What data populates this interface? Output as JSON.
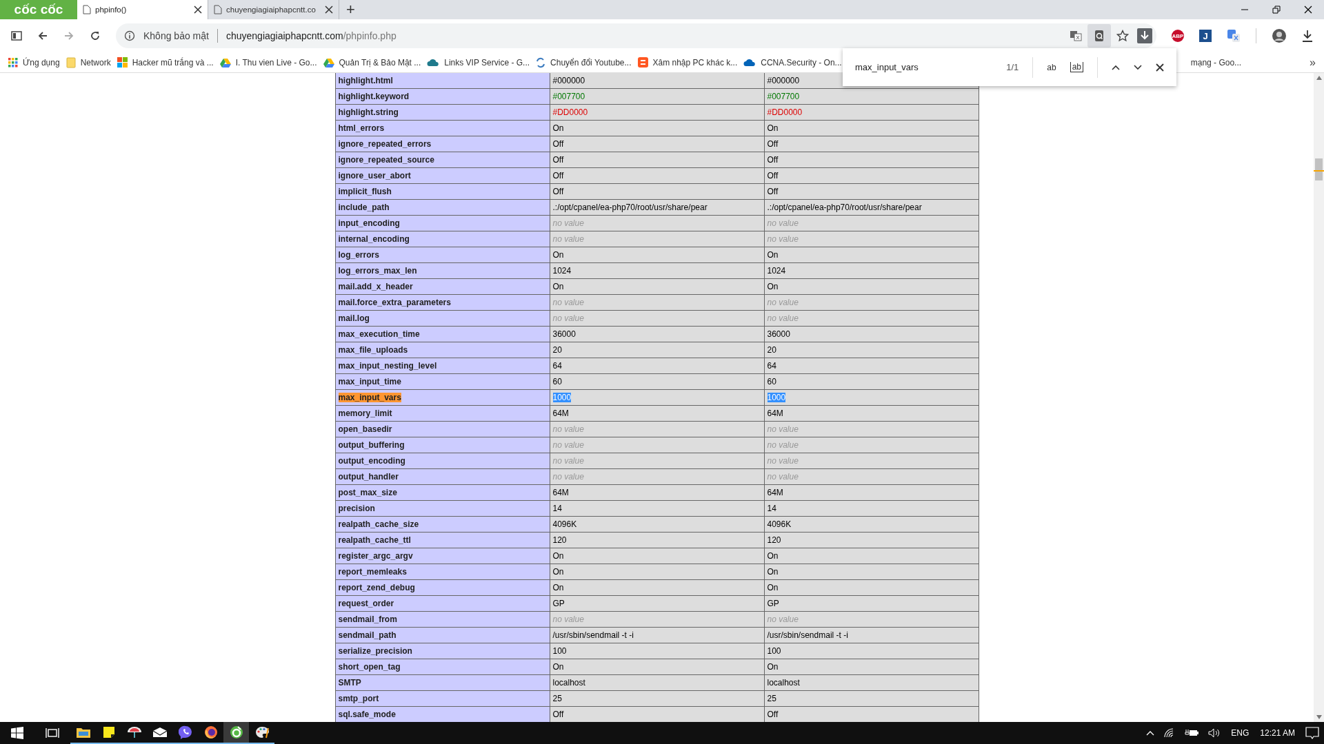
{
  "browser": {
    "logo": "cốc cốc",
    "tabs": [
      {
        "title": "phpinfo()",
        "selected": true
      },
      {
        "title": "chuyengiagiaiphapcntt.co",
        "selected": false
      }
    ],
    "new_tab": "+",
    "security": "Không bảo mật",
    "url_host": "chuyengiagiaiphapcntt.com",
    "url_path": "/phpinfo.php",
    "bookmarks": [
      {
        "label": "Ứng dụng",
        "kind": "apps"
      },
      {
        "label": "Network",
        "kind": "folder"
      },
      {
        "label": "Hacker mũ trắng và ...",
        "kind": "tiles"
      },
      {
        "label": "I. Thu vien Live - Go...",
        "kind": "drive"
      },
      {
        "label": "Quản Trị & Bảo Mật ...",
        "kind": "drive"
      },
      {
        "label": "Links VIP Service - G...",
        "kind": "cloud"
      },
      {
        "label": "Chuyển đổi Youtube...",
        "kind": "sync"
      },
      {
        "label": "Xâm nhập PC khác k...",
        "kind": "blog"
      },
      {
        "label": "CCNA.Security - On...",
        "kind": "onedrive"
      }
    ],
    "bookmark_partial": "mạng - Goo...",
    "bookmarks_more": "»",
    "extensions": [
      {
        "label": "ABP",
        "kind": "abp"
      },
      {
        "label": "J",
        "kind": "j"
      }
    ]
  },
  "find_bar": {
    "query": "max_input_vars",
    "count": "1/1",
    "match_case": "ab",
    "whole_word": "ab"
  },
  "table": {
    "rows": [
      {
        "name": "highlight.html",
        "found": false,
        "cells": [
          {
            "text": "#000000",
            "kind": "plain"
          },
          {
            "text": "#000000",
            "kind": "plain"
          }
        ]
      },
      {
        "name": "highlight.keyword",
        "found": false,
        "cells": [
          {
            "text": "#007700",
            "kind": "colored",
            "color": "#007700"
          },
          {
            "text": "#007700",
            "kind": "colored",
            "color": "#007700"
          }
        ]
      },
      {
        "name": "highlight.string",
        "found": false,
        "cells": [
          {
            "text": "#DD0000",
            "kind": "colored",
            "color": "#dd0000"
          },
          {
            "text": "#DD0000",
            "kind": "colored",
            "color": "#dd0000"
          }
        ]
      },
      {
        "name": "html_errors",
        "found": false,
        "cells": [
          {
            "text": "On",
            "kind": "plain"
          },
          {
            "text": "On",
            "kind": "plain"
          }
        ]
      },
      {
        "name": "ignore_repeated_errors",
        "found": false,
        "cells": [
          {
            "text": "Off",
            "kind": "plain"
          },
          {
            "text": "Off",
            "kind": "plain"
          }
        ]
      },
      {
        "name": "ignore_repeated_source",
        "found": false,
        "cells": [
          {
            "text": "Off",
            "kind": "plain"
          },
          {
            "text": "Off",
            "kind": "plain"
          }
        ]
      },
      {
        "name": "ignore_user_abort",
        "found": false,
        "cells": [
          {
            "text": "Off",
            "kind": "plain"
          },
          {
            "text": "Off",
            "kind": "plain"
          }
        ]
      },
      {
        "name": "implicit_flush",
        "found": false,
        "cells": [
          {
            "text": "Off",
            "kind": "plain"
          },
          {
            "text": "Off",
            "kind": "plain"
          }
        ]
      },
      {
        "name": "include_path",
        "found": false,
        "cells": [
          {
            "text": ".:/opt/cpanel/ea-php70/root/usr/share/pear",
            "kind": "plain"
          },
          {
            "text": ".:/opt/cpanel/ea-php70/root/usr/share/pear",
            "kind": "plain"
          }
        ]
      },
      {
        "name": "input_encoding",
        "found": false,
        "cells": [
          {
            "text": "no value",
            "kind": "empty"
          },
          {
            "text": "no value",
            "kind": "empty"
          }
        ]
      },
      {
        "name": "internal_encoding",
        "found": false,
        "cells": [
          {
            "text": "no value",
            "kind": "empty"
          },
          {
            "text": "no value",
            "kind": "empty"
          }
        ]
      },
      {
        "name": "log_errors",
        "found": false,
        "cells": [
          {
            "text": "On",
            "kind": "plain"
          },
          {
            "text": "On",
            "kind": "plain"
          }
        ]
      },
      {
        "name": "log_errors_max_len",
        "found": false,
        "cells": [
          {
            "text": "1024",
            "kind": "plain"
          },
          {
            "text": "1024",
            "kind": "plain"
          }
        ]
      },
      {
        "name": "mail.add_x_header",
        "found": false,
        "cells": [
          {
            "text": "On",
            "kind": "plain"
          },
          {
            "text": "On",
            "kind": "plain"
          }
        ]
      },
      {
        "name": "mail.force_extra_parameters",
        "found": false,
        "cells": [
          {
            "text": "no value",
            "kind": "empty"
          },
          {
            "text": "no value",
            "kind": "empty"
          }
        ]
      },
      {
        "name": "mail.log",
        "found": false,
        "cells": [
          {
            "text": "no value",
            "kind": "empty"
          },
          {
            "text": "no value",
            "kind": "empty"
          }
        ]
      },
      {
        "name": "max_execution_time",
        "found": false,
        "cells": [
          {
            "text": "36000",
            "kind": "plain"
          },
          {
            "text": "36000",
            "kind": "plain"
          }
        ]
      },
      {
        "name": "max_file_uploads",
        "found": false,
        "cells": [
          {
            "text": "20",
            "kind": "plain"
          },
          {
            "text": "20",
            "kind": "plain"
          }
        ]
      },
      {
        "name": "max_input_nesting_level",
        "found": false,
        "cells": [
          {
            "text": "64",
            "kind": "plain"
          },
          {
            "text": "64",
            "kind": "plain"
          }
        ]
      },
      {
        "name": "max_input_time",
        "found": false,
        "cells": [
          {
            "text": "60",
            "kind": "plain"
          },
          {
            "text": "60",
            "kind": "plain"
          }
        ]
      },
      {
        "name": "max_input_vars",
        "found": true,
        "cells": [
          {
            "text": "1000",
            "kind": "plain"
          },
          {
            "text": "1000",
            "kind": "plain"
          }
        ]
      },
      {
        "name": "memory_limit",
        "found": false,
        "cells": [
          {
            "text": "64M",
            "kind": "plain"
          },
          {
            "text": "64M",
            "kind": "plain"
          }
        ]
      },
      {
        "name": "open_basedir",
        "found": false,
        "cells": [
          {
            "text": "no value",
            "kind": "empty"
          },
          {
            "text": "no value",
            "kind": "empty"
          }
        ]
      },
      {
        "name": "output_buffering",
        "found": false,
        "cells": [
          {
            "text": "no value",
            "kind": "empty"
          },
          {
            "text": "no value",
            "kind": "empty"
          }
        ]
      },
      {
        "name": "output_encoding",
        "found": false,
        "cells": [
          {
            "text": "no value",
            "kind": "empty"
          },
          {
            "text": "no value",
            "kind": "empty"
          }
        ]
      },
      {
        "name": "output_handler",
        "found": false,
        "cells": [
          {
            "text": "no value",
            "kind": "empty"
          },
          {
            "text": "no value",
            "kind": "empty"
          }
        ]
      },
      {
        "name": "post_max_size",
        "found": false,
        "cells": [
          {
            "text": "64M",
            "kind": "plain"
          },
          {
            "text": "64M",
            "kind": "plain"
          }
        ]
      },
      {
        "name": "precision",
        "found": false,
        "cells": [
          {
            "text": "14",
            "kind": "plain"
          },
          {
            "text": "14",
            "kind": "plain"
          }
        ]
      },
      {
        "name": "realpath_cache_size",
        "found": false,
        "cells": [
          {
            "text": "4096K",
            "kind": "plain"
          },
          {
            "text": "4096K",
            "kind": "plain"
          }
        ]
      },
      {
        "name": "realpath_cache_ttl",
        "found": false,
        "cells": [
          {
            "text": "120",
            "kind": "plain"
          },
          {
            "text": "120",
            "kind": "plain"
          }
        ]
      },
      {
        "name": "register_argc_argv",
        "found": false,
        "cells": [
          {
            "text": "On",
            "kind": "plain"
          },
          {
            "text": "On",
            "kind": "plain"
          }
        ]
      },
      {
        "name": "report_memleaks",
        "found": false,
        "cells": [
          {
            "text": "On",
            "kind": "plain"
          },
          {
            "text": "On",
            "kind": "plain"
          }
        ]
      },
      {
        "name": "report_zend_debug",
        "found": false,
        "cells": [
          {
            "text": "On",
            "kind": "plain"
          },
          {
            "text": "On",
            "kind": "plain"
          }
        ]
      },
      {
        "name": "request_order",
        "found": false,
        "cells": [
          {
            "text": "GP",
            "kind": "plain"
          },
          {
            "text": "GP",
            "kind": "plain"
          }
        ]
      },
      {
        "name": "sendmail_from",
        "found": false,
        "cells": [
          {
            "text": "no value",
            "kind": "empty"
          },
          {
            "text": "no value",
            "kind": "empty"
          }
        ]
      },
      {
        "name": "sendmail_path",
        "found": false,
        "cells": [
          {
            "text": "/usr/sbin/sendmail -t -i",
            "kind": "plain"
          },
          {
            "text": "/usr/sbin/sendmail -t -i",
            "kind": "plain"
          }
        ]
      },
      {
        "name": "serialize_precision",
        "found": false,
        "cells": [
          {
            "text": "100",
            "kind": "plain"
          },
          {
            "text": "100",
            "kind": "plain"
          }
        ]
      },
      {
        "name": "short_open_tag",
        "found": false,
        "cells": [
          {
            "text": "On",
            "kind": "plain"
          },
          {
            "text": "On",
            "kind": "plain"
          }
        ]
      },
      {
        "name": "SMTP",
        "found": false,
        "cells": [
          {
            "text": "localhost",
            "kind": "plain"
          },
          {
            "text": "localhost",
            "kind": "plain"
          }
        ]
      },
      {
        "name": "smtp_port",
        "found": false,
        "cells": [
          {
            "text": "25",
            "kind": "plain"
          },
          {
            "text": "25",
            "kind": "plain"
          }
        ]
      },
      {
        "name": "sql.safe_mode",
        "found": false,
        "cells": [
          {
            "text": "Off",
            "kind": "plain"
          },
          {
            "text": "Off",
            "kind": "plain"
          }
        ]
      }
    ]
  },
  "taskbar": {
    "apps": [
      {
        "kind": "explorer",
        "active": false
      },
      {
        "kind": "notes",
        "active": false
      },
      {
        "kind": "app",
        "active": false
      },
      {
        "kind": "mail",
        "active": false
      },
      {
        "kind": "viber",
        "active": false
      },
      {
        "kind": "firefox",
        "active": false
      },
      {
        "kind": "coccoc",
        "active": true
      },
      {
        "kind": "paint",
        "active": false
      }
    ],
    "language": "ENG",
    "time": "12:21 AM"
  }
}
